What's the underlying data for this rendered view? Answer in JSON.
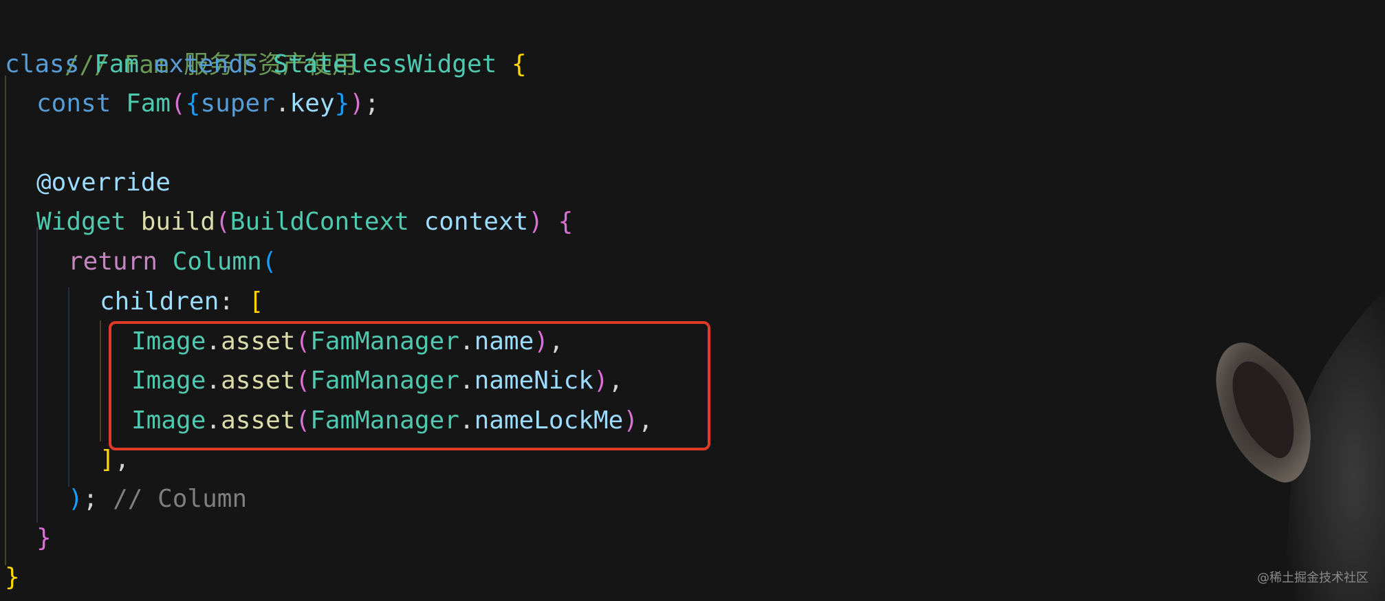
{
  "editor": {
    "lines": [
      {
        "comment": "/// Fam 服务下资产使用"
      },
      {
        "kw_class": "class",
        "name": "Fam",
        "kw_extends": "extends",
        "base": "StatelessWidget",
        "open": "{"
      },
      {
        "kw_const": "const",
        "name": "Fam",
        "p_open": "(",
        "b_open": "{",
        "super": "super",
        "dot": ".",
        "key": "key",
        "b_close": "}",
        "p_close": ")",
        "semi": ";"
      },
      {},
      {
        "annotation": "@override"
      },
      {
        "type": "Widget",
        "fn": "build",
        "p_open": "(",
        "param_type": "BuildContext",
        "param": "context",
        "p_close": ")",
        "open": "{"
      },
      {
        "kw_return": "return",
        "type": "Column",
        "p_open": "("
      },
      {
        "prop": "children",
        "colon": ":",
        "open": "["
      },
      {
        "cls": "Image",
        "dot": ".",
        "fn": "asset",
        "p_open": "(",
        "mgr": "FamManager",
        "dot2": ".",
        "field": "name",
        "p_close": ")",
        "comma": ","
      },
      {
        "cls": "Image",
        "dot": ".",
        "fn": "asset",
        "p_open": "(",
        "mgr": "FamManager",
        "dot2": ".",
        "field": "nameNick",
        "p_close": ")",
        "comma": ","
      },
      {
        "cls": "Image",
        "dot": ".",
        "fn": "asset",
        "p_open": "(",
        "mgr": "FamManager",
        "dot2": ".",
        "field": "nameLockMe",
        "p_close": ")",
        "comma": ","
      },
      {
        "close": "]",
        "comma": ","
      },
      {
        "p_close": ")",
        "semi": ";",
        "comment": "// Column"
      },
      {
        "close": "}"
      },
      {
        "close": "}"
      }
    ]
  },
  "colors": {
    "background": "#151515",
    "comment": "#6a9955",
    "keyword": "#569cd6",
    "type": "#4ec9b0",
    "function": "#dcdcaa",
    "variable": "#9cdcfe",
    "highlight_border": "#e03a2a"
  },
  "watermark": "@稀土掘金技术社区",
  "mascot": "chimpanzee-ear-image"
}
